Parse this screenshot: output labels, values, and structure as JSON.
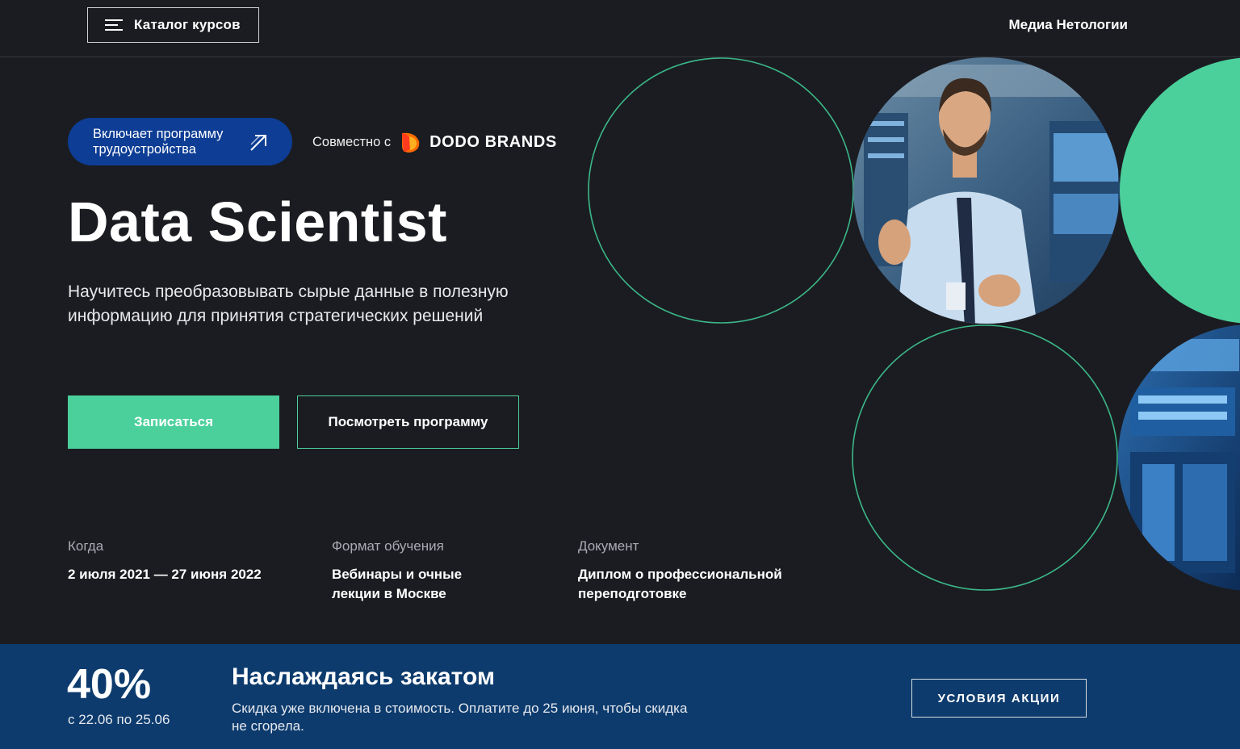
{
  "header": {
    "catalog_label": "Каталог курсов",
    "media_label": "Медиа Нетологии"
  },
  "hero": {
    "badge_text": "Включает программу трудоустройства",
    "partner_prefix": "Совместно с",
    "partner_name": "DODO BRANDS",
    "title": "Data Scientist",
    "subtitle": "Научитесь преобразовывать сырые данные в полезную информацию для принятия стратегических решений",
    "signup_label": "Записаться",
    "program_label": "Посмотреть программу"
  },
  "info": {
    "when_label": "Когда",
    "when_value": "2 июля 2021 — 27 июня 2022",
    "format_label": "Формат обучения",
    "format_value": "Вебинары и очные лекции в Москве",
    "document_label": "Документ",
    "document_value": "Диплом о профессиональной переподготовке"
  },
  "promo": {
    "percent": "40%",
    "dates": "с 22.06 по 25.06",
    "title": "Наслаждаясь закатом",
    "description": "Скидка уже включена в стоимость. Оплатите до 25 июня, чтобы скидка не сгорела.",
    "terms_label": "УСЛОВИЯ АКЦИИ"
  },
  "colors": {
    "background": "#1b1c21",
    "accent_green": "#4bd09c",
    "badge_blue": "#0d3d94",
    "promo_blue": "#0d3b6d",
    "dodo_orange": "#ff6a00"
  },
  "icons": {
    "menu": "hamburger-menu-icon",
    "badge_arrow": "arrow-up-right-icon",
    "partner_logo": "dodo-logo-icon"
  }
}
